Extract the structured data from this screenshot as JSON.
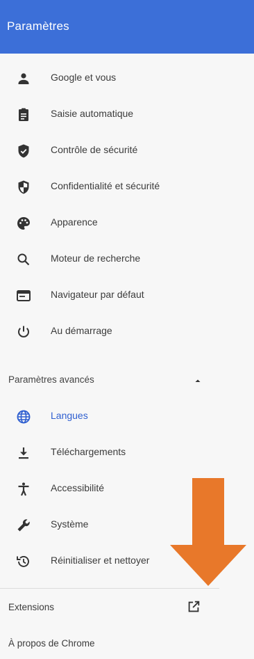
{
  "header": {
    "title": "Paramètres"
  },
  "nav": {
    "items": [
      {
        "label": "Google et vous",
        "icon": "person-icon"
      },
      {
        "label": "Saisie automatique",
        "icon": "clipboard-icon"
      },
      {
        "label": "Contrôle de sécurité",
        "icon": "shield-check-icon"
      },
      {
        "label": "Confidentialité et sécurité",
        "icon": "shield-half-icon"
      },
      {
        "label": "Apparence",
        "icon": "palette-icon"
      },
      {
        "label": "Moteur de recherche",
        "icon": "search-icon"
      },
      {
        "label": "Navigateur par défaut",
        "icon": "browser-window-icon"
      },
      {
        "label": "Au démarrage",
        "icon": "power-icon"
      }
    ],
    "advanced_label": "Paramètres avancés",
    "advanced": [
      {
        "label": "Langues",
        "icon": "globe-icon",
        "active": true
      },
      {
        "label": "Téléchargements",
        "icon": "download-icon"
      },
      {
        "label": "Accessibilité",
        "icon": "accessibility-icon"
      },
      {
        "label": "Système",
        "icon": "wrench-icon"
      },
      {
        "label": "Réinitialiser et nettoyer",
        "icon": "restore-icon"
      }
    ],
    "extensions_label": "Extensions",
    "about_label": "À propos de Chrome"
  },
  "colors": {
    "header": "#3c6fd8",
    "active": "#2f5fd0",
    "arrow": "#e8782a"
  }
}
